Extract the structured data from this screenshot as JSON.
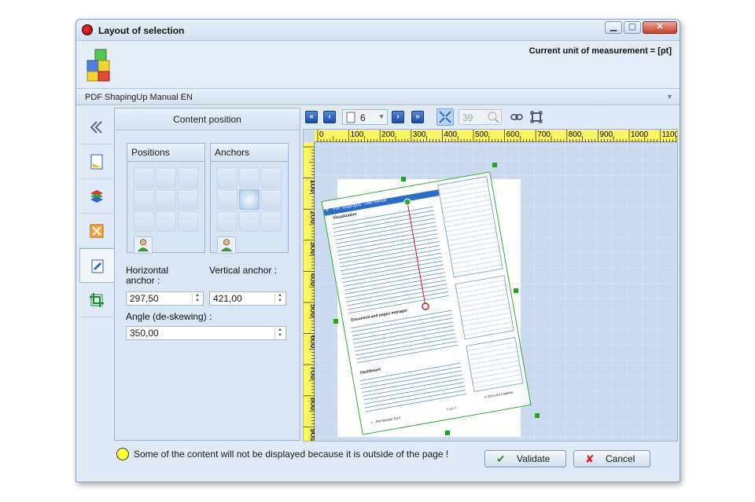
{
  "window": {
    "title": "Layout of selection",
    "min": "▁",
    "max": "▢",
    "close": "✕"
  },
  "header": {
    "unit_text": "Current unit of measurement = [pt]"
  },
  "document": {
    "name": "PDF ShapingUp Manual EN"
  },
  "sidetabs": [
    "arrows-back-icon",
    "document-ruler-icon",
    "layers-icon",
    "resize-icon",
    "pin-icon",
    "crop-icon"
  ],
  "panel": {
    "title": "Content position",
    "positions_label": "Positions",
    "anchors_label": "Anchors",
    "selected_anchor": 4,
    "h_anchor_label": "Horizontal anchor :",
    "v_anchor_label": "Vertical anchor :",
    "h_anchor_value": "297,50",
    "v_anchor_value": "421,00",
    "angle_label": "Angle (de-skewing) :",
    "angle_value": "350,00"
  },
  "toolbar": {
    "page": "6",
    "zoom": "39"
  },
  "ruler": {
    "h_labels": [
      "0",
      "100",
      "200",
      "300",
      "400",
      "500",
      "600",
      "700",
      "800",
      "900",
      "1000",
      "1100"
    ],
    "v_labels": [
      "100",
      "200",
      "300",
      "400",
      "500",
      "600",
      "700",
      "800",
      "900"
    ]
  },
  "preview": {
    "page_header": "PDF ShapingUp - User manual",
    "page_number": "6",
    "sections": [
      "Visualization",
      "Document and pages manager",
      "Dashboard"
    ],
    "footer_text": "© 2010-2013 Apifelio",
    "footer_link": "Page 6",
    "footer_left": "1 – PDFSkidder 2013"
  },
  "footer": {
    "warning": "Some of the content will not be displayed because it is outside of the page !",
    "validate": "Validate",
    "cancel": "Cancel"
  },
  "colors": {
    "accent": "#2b6cc4",
    "ruler": "#fbf465",
    "selection": "#33a833",
    "anchor_line": "#d01818"
  }
}
